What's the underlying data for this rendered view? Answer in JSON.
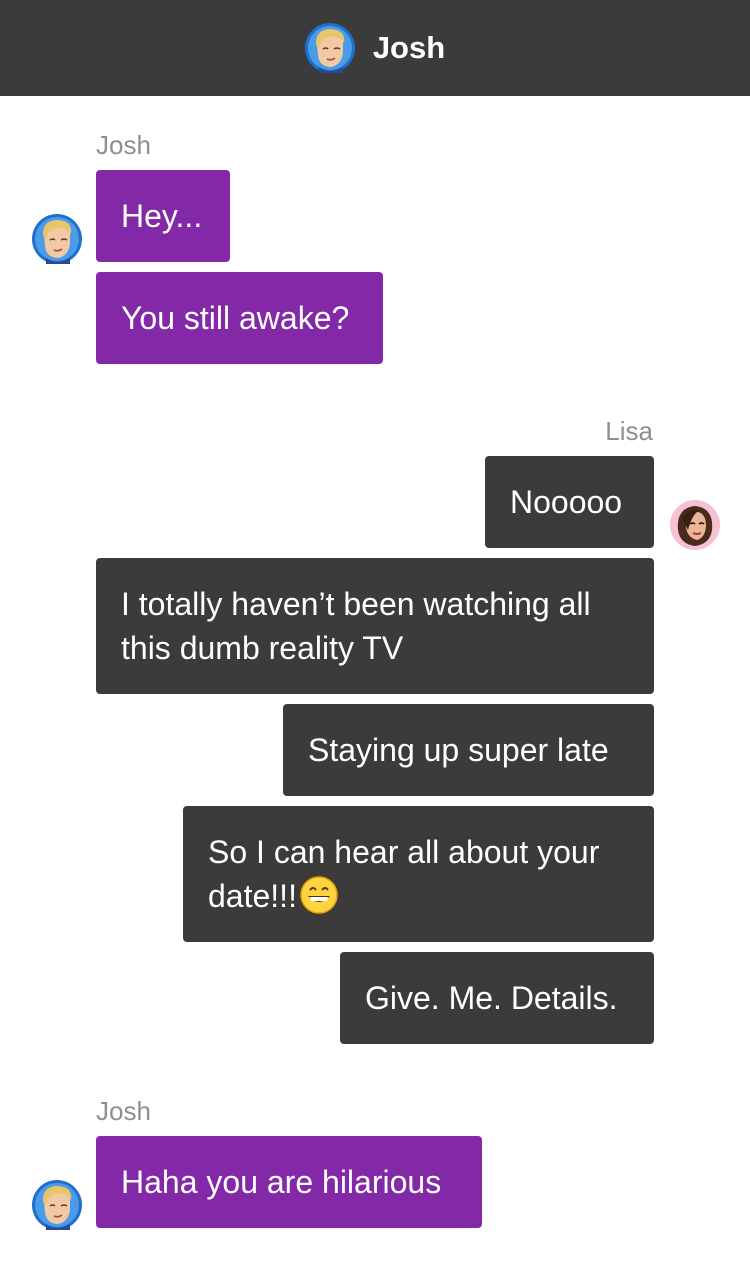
{
  "header": {
    "title": "Josh",
    "avatar_icon": "josh-avatar-icon"
  },
  "groups": [
    {
      "sender": "Josh",
      "messages": [
        "Hey...",
        "You still awake?"
      ]
    },
    {
      "sender": "Lisa",
      "messages": [
        "Nooooo",
        "I totally haven’t been watching all this dumb reality TV",
        "Staying up super late",
        "So I can hear all about your date!!!",
        "Give. Me. Details."
      ],
      "emoji": "grinning-face-icon"
    },
    {
      "sender": "Josh",
      "messages": [
        "Haha you are hilarious"
      ]
    }
  ],
  "colors": {
    "header_bg": "#3b3b3b",
    "josh_bubble": "#8329a8",
    "lisa_bubble": "#3b3b3b",
    "sender_name": "#8f8f8f"
  }
}
